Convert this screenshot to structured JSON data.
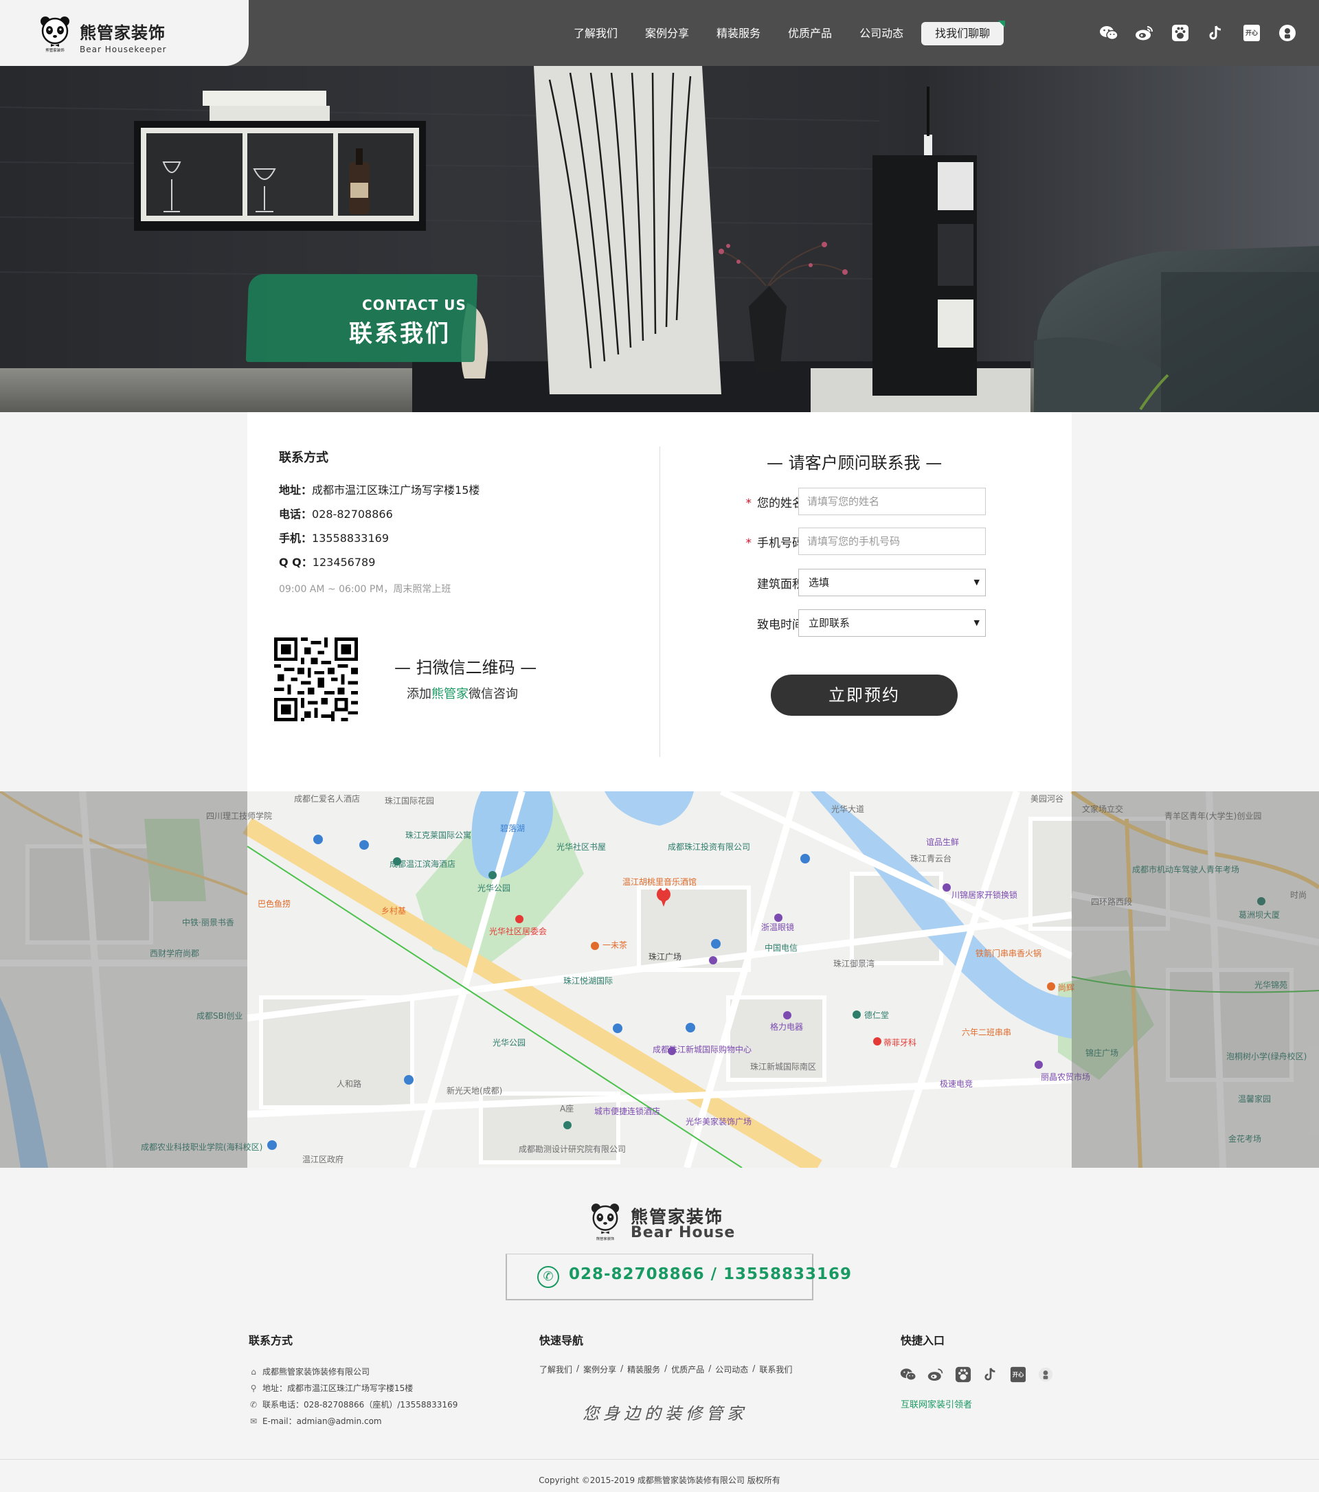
{
  "header": {
    "logo_cn": "熊管家装饰",
    "logo_en": "Bear Housekeeper",
    "logo_badge": "熊管家装饰",
    "nav": [
      {
        "label": "了解我们"
      },
      {
        "label": "案例分享"
      },
      {
        "label": "精装服务"
      },
      {
        "label": "优质产品"
      },
      {
        "label": "公司动态"
      },
      {
        "label": "找我们聊聊",
        "active": true
      }
    ],
    "social_icons": [
      "wechat-icon",
      "weibo-icon",
      "baidu-paw-icon",
      "douyin-icon",
      "kaixin-icon",
      "toutiao-icon"
    ],
    "kaixin_label": "开心"
  },
  "banner": {
    "tag_en": "CONTACT US",
    "tag_cn": "联系我们"
  },
  "contact": {
    "title": "联系方式",
    "address_label": "地址：",
    "address": "成都市温江区珠江广场写字楼15楼",
    "phone_label": "电话：",
    "phone": "028-82708866",
    "mobile_label": "手机：",
    "mobile": "13558833169",
    "qq_label": "Q Q：",
    "qq": "123456789",
    "hours": "09:00 AM ~ 06:00 PM，周末照常上班",
    "qr_title": "— 扫微信二维码 —",
    "qr_sub_pre": "添加",
    "qr_sub_brand": "熊管家",
    "qr_sub_post": "微信咨询"
  },
  "form": {
    "title": "— 请客户顾问联系我 —",
    "name_label": "您的姓名",
    "name_placeholder": "请填写您的姓名",
    "phone_label": "手机号码",
    "phone_placeholder": "请填写您的手机号码",
    "area_label": "建筑面积",
    "area_value": "选填",
    "time_label": "致电时间",
    "time_value": "立即联系",
    "required_mark": "*",
    "submit": "立即预约"
  },
  "map": {
    "labels": [
      "珠江国际花园",
      "碧落湖",
      "光华社区书屋",
      "成都珠江投资有限公司",
      "温江胡桃里音乐酒馆",
      "光华公园",
      "光华社区居委会",
      "乡村基",
      "巴色鱼捞",
      "成都温江滨海酒店",
      "珠江克莱国际公寓",
      "一未茶",
      "珠江广场",
      "珠江悦湖国际",
      "浙温眼镜",
      "中国电信",
      "珠江御景湾",
      "德仁堂",
      "格力电器",
      "蒂菲牙科",
      "六年二班串串",
      "极速电竞",
      "丽晶农贸市场",
      "铁箭门串串香火锅",
      "川锦居家开锁换锁",
      "谊品生鲜",
      "珠江青云台",
      "光华公园",
      "新光天地(成都)",
      "成都珠江新城国际购物中心",
      "珠江新城国际南区",
      "城市便捷连锁酒店",
      "光华美家装饰广场",
      "成都勘测设计研究院有限公司",
      "温江区政府",
      "A座",
      "成都仁爱名人酒店",
      "四川理工技师学院",
      "中铁·丽景书香",
      "西财学府尚郡",
      "成都SBI创业",
      "成都农业科技职业学院(海科校区)",
      "人和路",
      "文家场立交",
      "青羊区青年(大学生)创业园",
      "成都市机动车驾驶人青年考场",
      "葛洲坝大厦",
      "光华锦苑",
      "泡桐树小学(绿舟校区)",
      "温馨家园",
      "金花考场",
      "四环路西段",
      "美园河谷",
      "光华大道",
      "尚辉",
      "锦庄广场",
      "时尚"
    ]
  },
  "footer": {
    "logo_cn": "熊管家装饰",
    "logo_en": "Bear House",
    "phone_banner": "028-82708866 / 13558833169",
    "contact_title": "联系方式",
    "contact_lines": [
      {
        "icon": "home-icon",
        "text": "成都熊管家装饰装修有限公司"
      },
      {
        "icon": "location-icon",
        "text": "地址：成都市温江区珠江广场写字楼15楼"
      },
      {
        "icon": "phone-icon",
        "text": "联系电话：028-82708866（座机）/13558833169"
      },
      {
        "icon": "mail-icon",
        "text": "E-mail：admian@admin.com"
      }
    ],
    "nav_title": "快速导航",
    "nav": [
      "了解我们",
      "案例分享",
      "精装服务",
      "优质产品",
      "公司动态",
      "联系我们"
    ],
    "nav_sep": "/",
    "slogan": "您身边的装修管家",
    "entry_title": "快捷入口",
    "leader": "互联网家装引领者",
    "copyright": "Copyright ©2015-2019    成都熊管家装饰装修有限公司 版权所有"
  },
  "colors": {
    "accent_green": "#1a9a63",
    "header_bg": "#464646",
    "button_dark": "#333333",
    "required_red": "#d0112b"
  }
}
